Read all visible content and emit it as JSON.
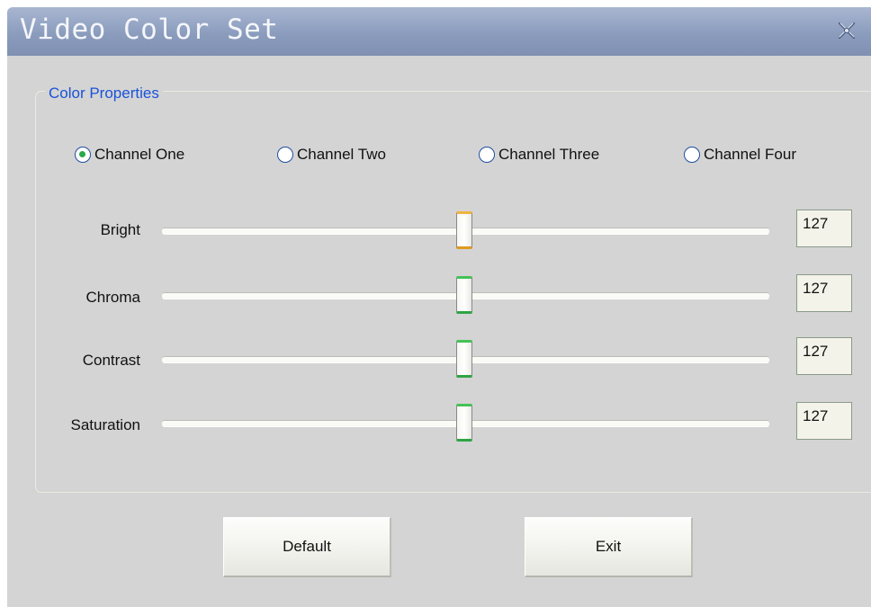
{
  "window": {
    "title": "Video Color Set",
    "close_icon": "close-icon"
  },
  "group": {
    "label": "Color Properties"
  },
  "channels": [
    {
      "label": "Channel One",
      "checked": true
    },
    {
      "label": "Channel Two",
      "checked": false
    },
    {
      "label": "Channel Three",
      "checked": false
    },
    {
      "label": "Channel Four",
      "checked": false
    }
  ],
  "sliders": [
    {
      "label": "Bright",
      "value": "127",
      "min": 0,
      "max": 255,
      "thumb_color": "#f0b440"
    },
    {
      "label": "Chroma",
      "value": "127",
      "min": 0,
      "max": 255,
      "thumb_color": "#45c257"
    },
    {
      "label": "Contrast",
      "value": "127",
      "min": 0,
      "max": 255,
      "thumb_color": "#45c257"
    },
    {
      "label": "Saturation",
      "value": "127",
      "min": 0,
      "max": 255,
      "thumb_color": "#45c257"
    }
  ],
  "buttons": {
    "default_label": "Default",
    "exit_label": "Exit"
  },
  "colors": {
    "titlebar": "#8b9cbd",
    "accent": "#1a52d8",
    "background": "#d4d4d4"
  }
}
